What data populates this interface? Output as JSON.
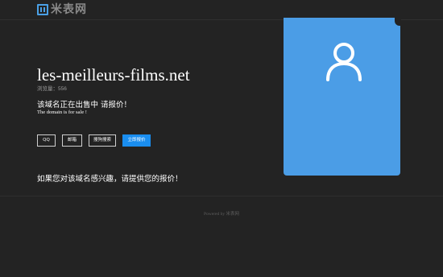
{
  "header": {
    "logo_text": "米表网",
    "logo_icon": "logo-m-icon",
    "accent_color": "#4aa0e6"
  },
  "main": {
    "domain": "les-meilleurs-films.net",
    "views_label": "浏览量：556",
    "sale_cn": "该域名正在出售中 请报价！",
    "sale_en": "The domain is for sale !",
    "buttons": {
      "qq": "QQ",
      "email": "邮箱",
      "sogou": "搜狗搜索",
      "offer": "立即报价"
    },
    "inquiry": "如果您对该域名感兴趣，请提供您的报价！"
  },
  "card": {
    "icon": "user-icon",
    "color": "#4b9de6"
  },
  "footer": {
    "text": "Powered by 米表网"
  },
  "colors": {
    "background": "#232323",
    "primary_button": "#1a8ef0"
  }
}
